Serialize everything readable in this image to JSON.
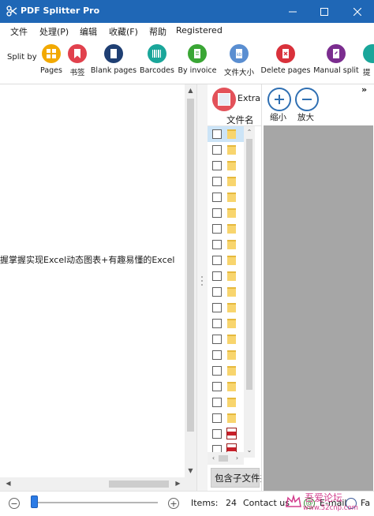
{
  "titlebar": {
    "title": "PDF Splitter Pro",
    "icon": "scissors-icon",
    "controls": [
      "minimize-icon",
      "maximize-icon",
      "close-icon"
    ]
  },
  "menu": {
    "items": [
      "文件",
      "处理(P)",
      "编辑",
      "收藏(F)",
      "帮助",
      "Registered"
    ]
  },
  "toolbar": {
    "split_by_label": "Split by",
    "buttons": [
      {
        "label": "Pages",
        "icon": "pages-grid-icon",
        "color": "#f2a900"
      },
      {
        "label": "书签",
        "icon": "bookmark-icon",
        "color": "#e1414d"
      },
      {
        "label": "Blank pages",
        "icon": "blank-page-icon",
        "color": "#1f3f73"
      },
      {
        "label": "Barcodes",
        "icon": "barcode-icon",
        "color": "#1aa69a"
      },
      {
        "label": "By invoice",
        "icon": "invoice-icon",
        "color": "#3aa635"
      },
      {
        "label": "文件大小",
        "icon": "file-size-icon",
        "color": "#5a8ed1"
      },
      {
        "label": "Delete pages",
        "icon": "delete-pages-icon",
        "color": "#d9313b"
      },
      {
        "label": "Manual split",
        "icon": "manual-split-icon",
        "color": "#7b2d8f"
      },
      {
        "label": "提",
        "icon": "extract-teal-icon",
        "color": "#1aa69a"
      }
    ],
    "overflow": "»"
  },
  "preview": {
    "text": "握掌握实现Excel动态图表+有趣易懂的Excel"
  },
  "files": {
    "extract_label": "Extra",
    "column_header": "文件名",
    "subfolder_label": "包含子文件夹",
    "rows": [
      {
        "type": "folder",
        "selected": true
      },
      {
        "type": "folder"
      },
      {
        "type": "folder"
      },
      {
        "type": "folder"
      },
      {
        "type": "folder"
      },
      {
        "type": "folder"
      },
      {
        "type": "folder"
      },
      {
        "type": "folder"
      },
      {
        "type": "folder"
      },
      {
        "type": "folder"
      },
      {
        "type": "folder"
      },
      {
        "type": "folder"
      },
      {
        "type": "folder"
      },
      {
        "type": "folder"
      },
      {
        "type": "folder"
      },
      {
        "type": "folder"
      },
      {
        "type": "folder"
      },
      {
        "type": "folder"
      },
      {
        "type": "folder"
      },
      {
        "type": "pdf"
      },
      {
        "type": "pdf"
      }
    ]
  },
  "right_panel": {
    "zoom_out_label": "缩小",
    "zoom_in_label": "放大",
    "collapse_glyph": "»"
  },
  "statusbar": {
    "minus": "−",
    "plus": "+",
    "items_label": "Items:",
    "items_count": "24",
    "contact_label": "Contact us",
    "email_label": "E-mail",
    "fa_label": "Fa"
  },
  "watermark": {
    "cn": "吾爱论坛",
    "url": "www.52cnp.com"
  },
  "colors": {
    "titlebar": "#1f67b6",
    "zoom_stroke": "#2f6fb2",
    "slider": "#2c7be5",
    "preview_gray": "#a6a6a6"
  }
}
